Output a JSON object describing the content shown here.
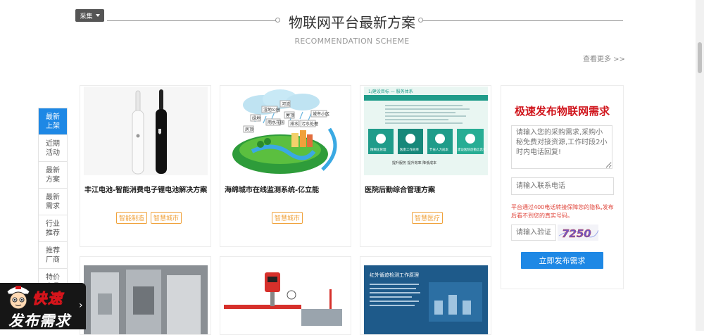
{
  "toolbar": {
    "collect_label": "采集"
  },
  "section": {
    "title": "物联网平台最新方案",
    "subtitle": "RECOMMENDATION SCHEME",
    "view_more": "查看更多 >>"
  },
  "side_tabs": [
    {
      "label": "最新上架",
      "active": true
    },
    {
      "label": "近期活动",
      "active": false
    },
    {
      "label": "最新方案",
      "active": false
    },
    {
      "label": "最新需求",
      "active": false
    },
    {
      "label": "行业推荐",
      "active": false
    },
    {
      "label": "推荐厂商",
      "active": false
    },
    {
      "label": "特价产品",
      "active": false
    }
  ],
  "cards": [
    {
      "title": "丰江电池-智能消费电子锂电池解决方案",
      "tags": [
        "智能制造",
        "智慧城市"
      ]
    },
    {
      "title": "海绵城市在线监测系统-亿立能",
      "tags": [
        "智慧城市"
      ]
    },
    {
      "title": "医院后勤综合管理方案",
      "tags": [
        "智慧医疗"
      ]
    }
  ],
  "illustration_labels": {
    "sponge_city": [
      "河流",
      "湿地公园",
      "绿地",
      "雨水花园",
      "房顶",
      "屋顶",
      "排水",
      "污水处理",
      "城市小区"
    ],
    "hospital_header": "1/建设目标 — 服务体系",
    "hospital_tiles": [
      "精细化管理",
      "医患工作效率",
      "节省人力成本",
      "建设医院后勤信息化"
    ],
    "hospital_footer": "提升服务 提升效率 降低成本",
    "infrared_title": "红外循迹检测工作原理"
  },
  "form": {
    "title": "极速发布物联网需求",
    "textarea_placeholder": "请输入您的采购需求,采购小秘免费对接资源,工作时段2小时内电话回复!",
    "phone_placeholder": "请输入联系电话",
    "notice": "平台通过400电话转接保障您的隐私,发布后看不到您的真实号码。",
    "vcode_placeholder": "请输入验证码",
    "captcha_text": "7250",
    "submit_label": "立即发布需求"
  },
  "badge": {
    "line1": "快速",
    "line2": "发布需求"
  },
  "colors": {
    "accent": "#1e88e5",
    "tag": "#f0a23b",
    "form_title": "#d0151c",
    "notice": "#e0473d"
  }
}
